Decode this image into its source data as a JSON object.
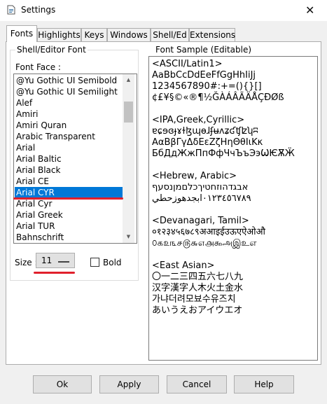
{
  "window": {
    "title": "Settings",
    "close_glyph": "✕"
  },
  "tabs": [
    "Fonts",
    "Highlights",
    "Keys",
    "Windows",
    "Shell/Ed",
    "Extensions"
  ],
  "shell_editor": {
    "group_title": "Shell/Editor Font",
    "font_face_label": "Font Face :",
    "fonts": [
      "@Yu Gothic UI Semibold",
      "@Yu Gothic UI Semilight",
      "Alef",
      "Amiri",
      "Amiri Quran",
      "Arabic Transparent",
      "Arial",
      "Arial Baltic",
      "Arial Black",
      "Arial CE",
      "Arial CYR",
      "Arial Cyr",
      "Arial Greek",
      "Arial TUR",
      "Bahnschrift"
    ],
    "selected_font": "Arial CYR",
    "size_label": "Size :",
    "size_value": "11",
    "bold_label": "Bold",
    "bold_checked": false
  },
  "sample": {
    "title": "Font Sample (Editable)",
    "text": "<ASCII/Latin1>\nAaBbCcDdEeFfGgHhIiJj\n1234567890#:+=(){}[]\n¢£¥§©«®¶½ĞÀÁÂÃÄÅÇĐØß\n\n<IPA,Greek,Cyrillic>\nɐɕɘɞɟɤɫɮɰɵɺʄʉʌʑʛʧʫʮʭ\nΑαΒβΓγΔδΕεΖζΗηΘθΙιΚκ\nБбДдЖжПпФфЧчЪъЭэѠѤѪӜ\n\n<Hebrew, Arabic>\nאבגדהוזחטיךכלםמןנסעף\n٠١٢٣٤٥٦٧٨٩ابجدهوزحطي\n\n<Devanagari, Tamil>\n०१२३४५६७८९अआइईउऊएऐओऔ\n௦௧௨௩௪௫௬௭௮௯அஇஉஎ\n\n<East Asian>\n〇一二三四五六七八九\n汉字漢字人木火土金水\n가냐더려모뵤수유즈치\nあいうえおアイウエオ"
  },
  "buttons": {
    "ok": "Ok",
    "apply": "Apply",
    "cancel": "Cancel",
    "help": "Help"
  },
  "colors": {
    "selection": "#0078d7",
    "highlight_underline": "#e0202c"
  }
}
